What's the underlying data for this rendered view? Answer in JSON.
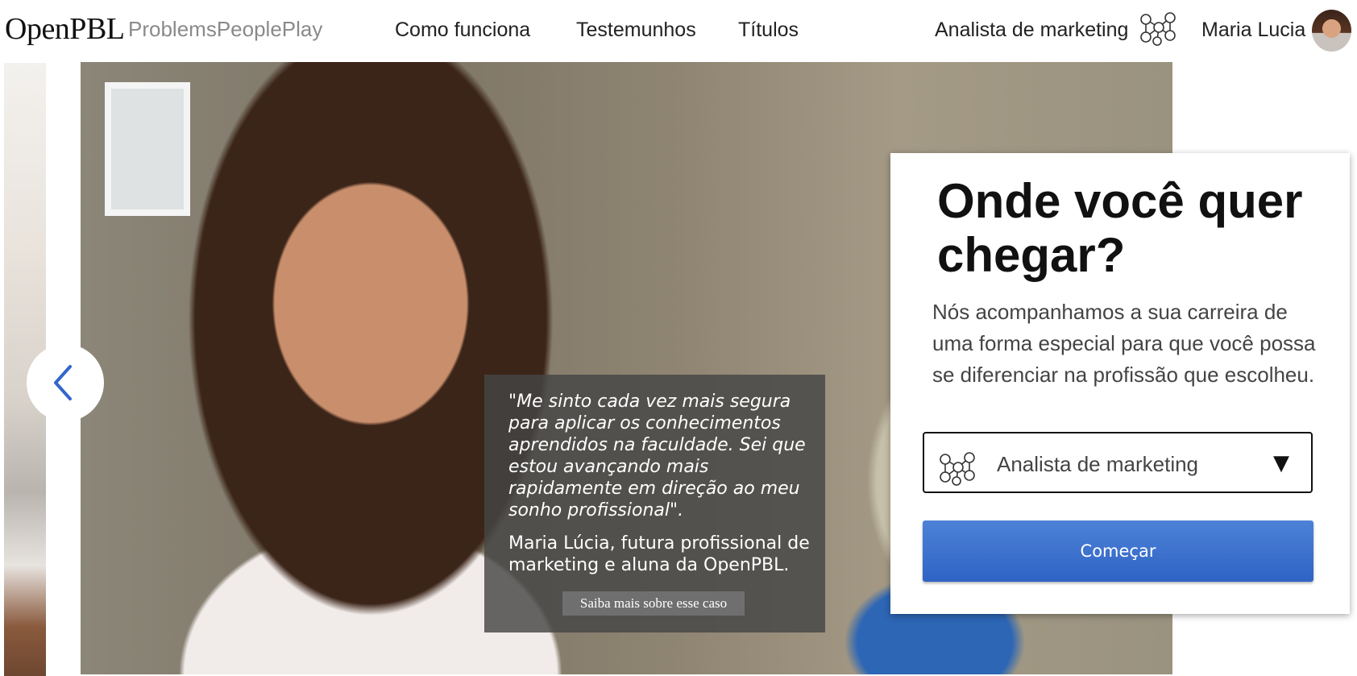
{
  "header": {
    "logo": "OpenPBL",
    "tagline": "ProblemsPeoplePlay",
    "nav": [
      "Como funciona",
      "Testemunhos",
      "Títulos"
    ],
    "career": "Analista de marketing",
    "user_name": "Maria Lucia"
  },
  "hero": {
    "quote": "\"Me sinto cada vez mais segura para aplicar os conhecimentos aprendidos na faculdade. Sei que estou avançando mais rapidamente em direção ao meu sonho profissional\".",
    "author": "Maria Lúcia, futura profissional de marketing e aluna da OpenPBL.",
    "cta": "Saiba mais sobre esse caso"
  },
  "card": {
    "title": "Onde você quer chegar?",
    "text": "Nós acompanhamos a sua carreira de uma forma especial para que você possa se diferenciar na profissão que escolheu.",
    "select_value": "Analista de marketing",
    "select_arrow": "▼",
    "button": "Começar"
  },
  "icons": {
    "network": "network-people-icon",
    "prev": "chevron-left-icon"
  },
  "colors": {
    "primary_button": "#3a6fcf",
    "arrow": "#3366cc",
    "quote_overlay": "#464646"
  }
}
